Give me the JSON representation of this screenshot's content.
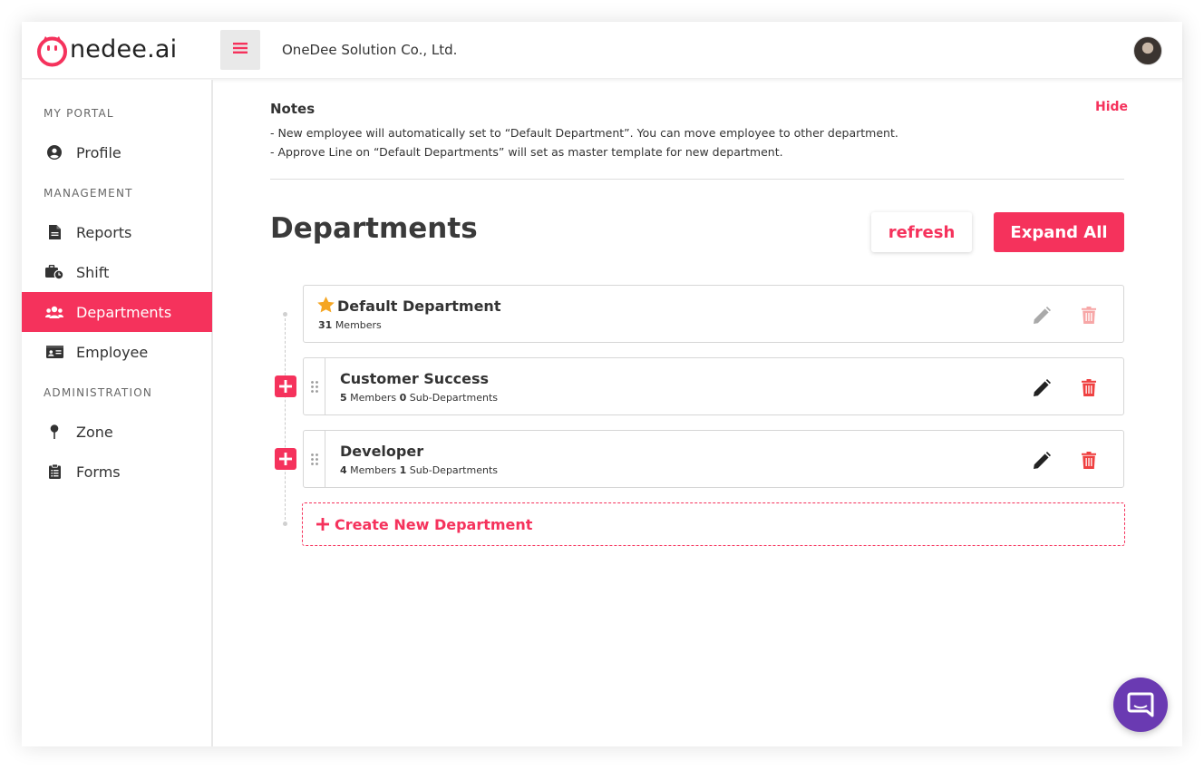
{
  "header": {
    "logo_text": "nedee.ai",
    "company_name": "OneDee Solution Co., Ltd."
  },
  "sidebar": {
    "sections": [
      {
        "title": "MY PORTAL",
        "items": [
          {
            "label": "Profile",
            "icon": "user-circle-icon"
          }
        ]
      },
      {
        "title": "MANAGEMENT",
        "items": [
          {
            "label": "Reports",
            "icon": "file-icon"
          },
          {
            "label": "Shift",
            "icon": "briefcase-clock-icon"
          },
          {
            "label": "Departments",
            "icon": "users-icon",
            "active": true
          },
          {
            "label": "Employee",
            "icon": "id-card-icon"
          }
        ]
      },
      {
        "title": "ADMINISTRATION",
        "items": [
          {
            "label": "Zone",
            "icon": "map-pin-icon"
          },
          {
            "label": "Forms",
            "icon": "clipboard-icon"
          }
        ]
      }
    ]
  },
  "notes": {
    "title": "Notes",
    "hide_label": "Hide",
    "lines": [
      "- New employee will automatically set to “Default Department”. You can move employee to other department.",
      "- Approve Line on “Default Departments” will set as master template for new department."
    ]
  },
  "page": {
    "title": "Departments",
    "refresh_label": "refresh",
    "expand_all_label": "Expand All",
    "create_label": "Create New Department"
  },
  "departments": [
    {
      "name": "Default Department",
      "members": "31",
      "members_label": "Members"
    },
    {
      "name": "Customer Success",
      "members": "5",
      "members_label": "Members",
      "sub": "0",
      "sub_label": "Sub-Departments"
    },
    {
      "name": "Developer",
      "members": "4",
      "members_label": "Members",
      "sub": "1",
      "sub_label": "Sub-Departments"
    }
  ],
  "colors": {
    "accent": "#f5325c",
    "star": "#f5a623",
    "chat": "#6a3ab2"
  }
}
